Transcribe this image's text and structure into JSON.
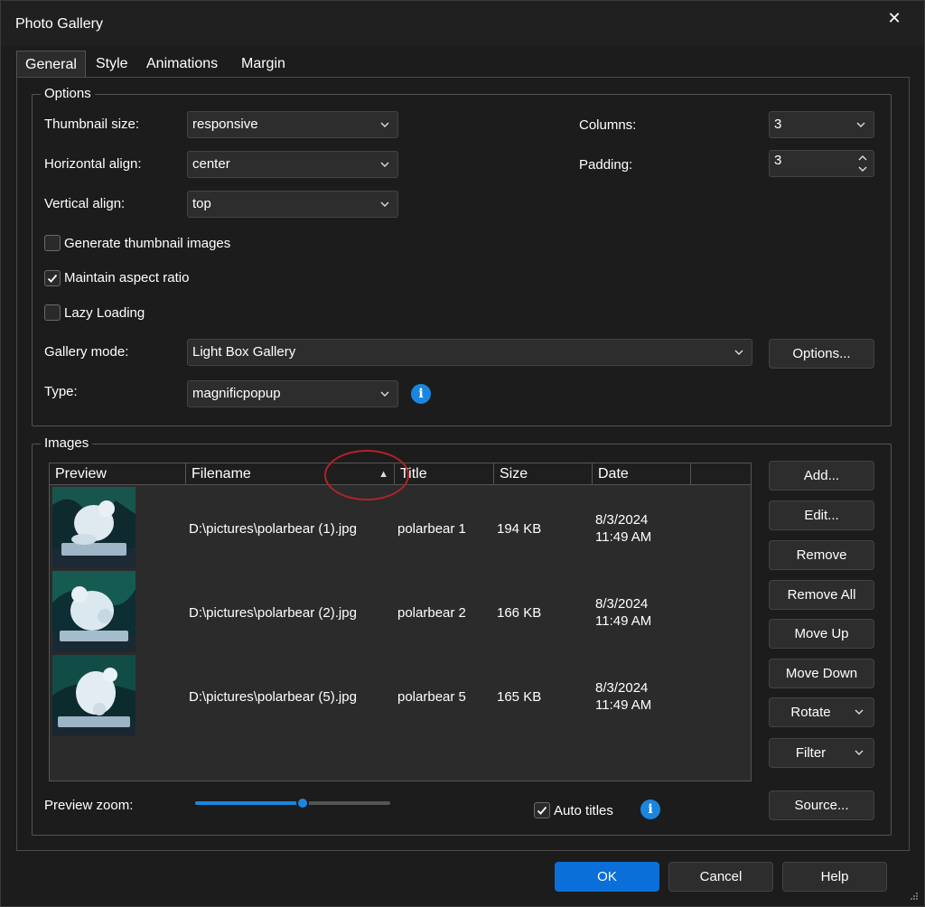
{
  "window": {
    "title": "Photo Gallery",
    "close_glyph": "✕"
  },
  "tabs": [
    {
      "label": "General",
      "active": true
    },
    {
      "label": "Style"
    },
    {
      "label": "Animations"
    },
    {
      "label": "Margin"
    }
  ],
  "options": {
    "legend": "Options",
    "thumbnail_size": {
      "label": "Thumbnail size:",
      "value": "responsive"
    },
    "horizontal_align": {
      "label": "Horizontal align:",
      "value": "center"
    },
    "vertical_align": {
      "label": "Vertical align:",
      "value": "top"
    },
    "columns": {
      "label": "Columns:",
      "value": "3"
    },
    "padding": {
      "label": "Padding:",
      "value": "3"
    },
    "generate_thumbnails": {
      "label": "Generate thumbnail images",
      "checked": false
    },
    "maintain_aspect": {
      "label": "Maintain aspect ratio",
      "checked": true
    },
    "lazy_loading": {
      "label": "Lazy Loading",
      "checked": false
    },
    "gallery_mode": {
      "label": "Gallery mode:",
      "value": "Light Box Gallery"
    },
    "options_button": "Options...",
    "type": {
      "label": "Type:",
      "value": "magnificpopup"
    }
  },
  "images": {
    "legend": "Images",
    "columns": [
      "Preview",
      "Filename",
      "Title",
      "Size",
      "Date"
    ],
    "sort_glyph": "▲",
    "rows": [
      {
        "filename": "D:\\pictures\\polarbear (1).jpg",
        "title": "polarbear 1",
        "size": "194 KB",
        "date": "8/3/2024",
        "time": "11:49 AM"
      },
      {
        "filename": "D:\\pictures\\polarbear (2).jpg",
        "title": "polarbear 2",
        "size": "166 KB",
        "date": "8/3/2024",
        "time": "11:49 AM"
      },
      {
        "filename": "D:\\pictures\\polarbear (5).jpg",
        "title": "polarbear 5",
        "size": "165 KB",
        "date": "8/3/2024",
        "time": "11:49 AM"
      }
    ],
    "buttons": {
      "add": "Add...",
      "edit": "Edit...",
      "remove": "Remove",
      "remove_all": "Remove All",
      "move_up": "Move Up",
      "move_down": "Move Down",
      "rotate": "Rotate",
      "filter": "Filter",
      "source": "Source..."
    },
    "preview_zoom": {
      "label": "Preview zoom:",
      "value": 0.55
    },
    "auto_titles": {
      "label": "Auto titles",
      "checked": true
    }
  },
  "footer": {
    "ok": "OK",
    "cancel": "Cancel",
    "help": "Help"
  },
  "colors": {
    "accent": "#1a86e0",
    "primary_button": "#0a6fd8",
    "annotation": "#b0242a"
  }
}
